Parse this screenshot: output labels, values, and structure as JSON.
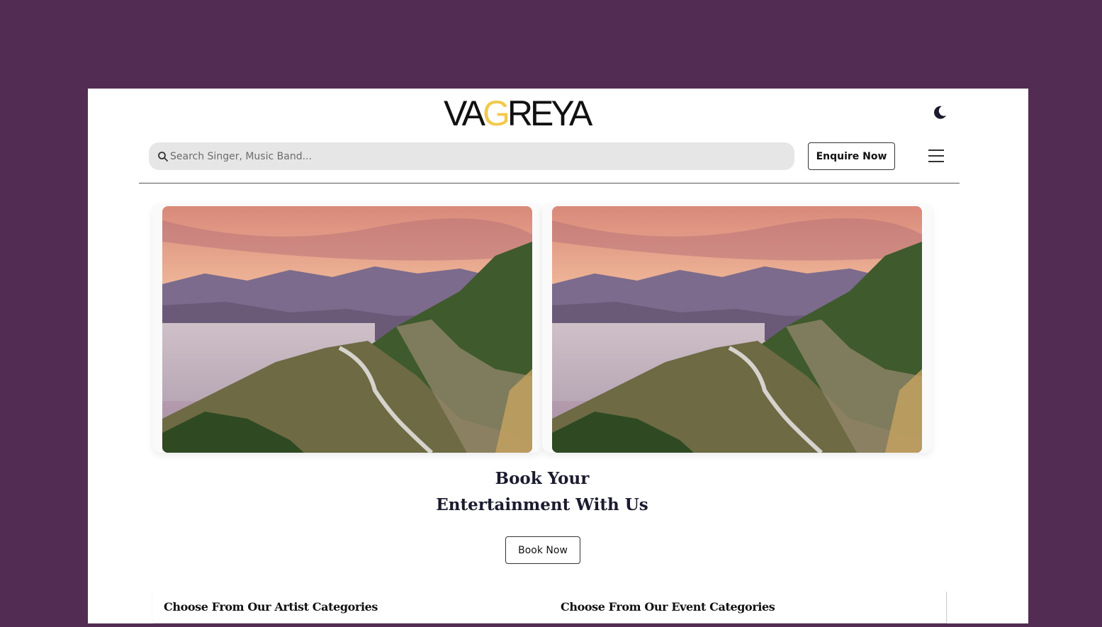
{
  "header": {
    "logo": {
      "part1": "VA",
      "part2": "G",
      "part3": "REYA",
      "accent_color": "#f2c94c"
    },
    "theme_toggle_icon": "moon-icon",
    "search": {
      "placeholder": "Search Singer, Music Band...",
      "value": "",
      "icon": "search-icon"
    },
    "enquire_label": "Enquire Now",
    "menu_icon": "hamburger-menu-icon"
  },
  "hero": {
    "banners": [
      {
        "icon": "landscape-image"
      },
      {
        "icon": "landscape-image"
      }
    ],
    "headline_line1": "Book Your",
    "headline_line2": "Entertainment With Us",
    "book_label": "Book Now"
  },
  "categories": {
    "artist_title": "Choose From Our Artist Categories",
    "event_title": "Choose From Our Event Categories"
  },
  "colors": {
    "background": "#532c54",
    "page": "#ffffff",
    "accent": "#f2c94c"
  }
}
